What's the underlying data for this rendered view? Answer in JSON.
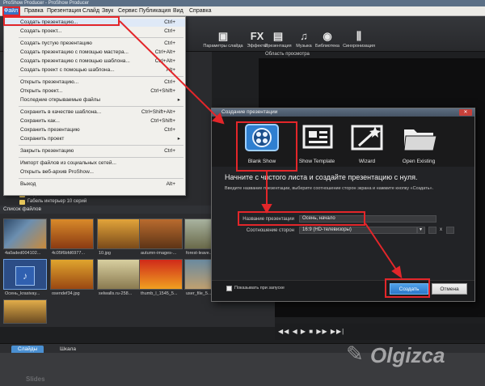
{
  "window": {
    "title": "ProShow Producer - ProShow Producer"
  },
  "menubar": {
    "items": [
      "Файл",
      "Правка",
      "Презентация",
      "Слайд",
      "Звук",
      "Сервис",
      "Публикация",
      "Вид",
      "Справка"
    ]
  },
  "toolbar": {
    "buttons": [
      {
        "label": "Параметры слайда",
        "icon": "slide-options-icon"
      },
      {
        "label": "Эффекты",
        "icon": "fx-icon",
        "glyph": "FX"
      },
      {
        "label": "Презентация",
        "icon": "presentation-icon"
      },
      {
        "label": "Музыка",
        "icon": "music-icon"
      },
      {
        "label": "Библиотека",
        "icon": "library-icon"
      },
      {
        "label": "Синхронизация",
        "icon": "sync-icon"
      }
    ]
  },
  "file_menu": {
    "items": [
      {
        "label": "Создать презентацию...",
        "shortcut": "Ctrl+",
        "highlight": true
      },
      {
        "label": "Создать проект...",
        "shortcut": "Ctrl+"
      },
      {
        "label": "Создать пустую презентацию",
        "shortcut": "Ctrl+"
      },
      {
        "label": "Создать презентацию с помощью мастера...",
        "shortcut": "Ctrl+Alt+"
      },
      {
        "label": "Создать презентацию с помощью шаблона...",
        "shortcut": "Ctrl+Alt+"
      },
      {
        "label": "Создать проект с помощью шаблона...",
        "shortcut": "Alt+"
      },
      {
        "label": "Открыть презентацию...",
        "shortcut": "Ctrl+"
      },
      {
        "label": "Открыть проект...",
        "shortcut": "Ctrl+Shift+"
      },
      {
        "label": "Последние открываемые файлы",
        "shortcut": "",
        "arrow": true
      },
      {
        "label": "Сохранить в качестве шаблона...",
        "shortcut": "Ctrl+Shift+Alt+"
      },
      {
        "label": "Сохранить как...",
        "shortcut": "Ctrl+Shift+"
      },
      {
        "label": "Сохранить презентацию",
        "shortcut": "Ctrl+"
      },
      {
        "label": "Сохранить проект",
        "shortcut": "",
        "arrow": true
      },
      {
        "label": "Закрыть презентацию",
        "shortcut": "Ctrl+"
      },
      {
        "label": "Импорт файлов из социальных сетей...",
        "shortcut": ""
      },
      {
        "label": "Открыть веб-архив ProShow...",
        "shortcut": ""
      },
      {
        "label": "Выход",
        "shortcut": "Alt+"
      }
    ]
  },
  "folder_tree": {
    "items": [
      "Видео",
      "Габель интерьер 10 серий"
    ]
  },
  "preview": {
    "label": "Область просмотра"
  },
  "file_list": {
    "header": "Список файлов",
    "files": [
      "4a0aded004102...",
      "4c05f6bfd6977...",
      "10.jpg",
      "autumn-images-...",
      "forest-leave...",
      "Осень_krasivay...",
      "osendef34.jpg",
      "selwalls.ru-258...",
      "thumb_l_1545_5...",
      "user_file_5..."
    ]
  },
  "dialog": {
    "title": "Создание презентации",
    "options": [
      "Blank Show",
      "Show Template",
      "Wizard",
      "Open Existing"
    ],
    "heading": "Начните с чистого листа и создайте презентацию с нуля.",
    "description": "Введите название презентации, выберите соотношение сторон экрана и нажмите кнопку «Создать».",
    "name_label": "Название презентации",
    "name_value": "Осень, начало",
    "ratio_label": "Соотношение сторон",
    "ratio_value": "16:9 (HD-телевизоры)",
    "ratio_x": "x",
    "checkbox_label": "Показывать при запуске",
    "create_label": "Создать",
    "cancel_label": "Отмена",
    "close_label": "✕"
  },
  "bottom_tabs": {
    "tabs": [
      "Слайды",
      "Шкала"
    ],
    "slides_label": "Slides"
  },
  "watermark": {
    "text": "Olgizca"
  },
  "colors": {
    "annotation_red": "#e3262a",
    "accent_blue": "#3a73c4"
  }
}
